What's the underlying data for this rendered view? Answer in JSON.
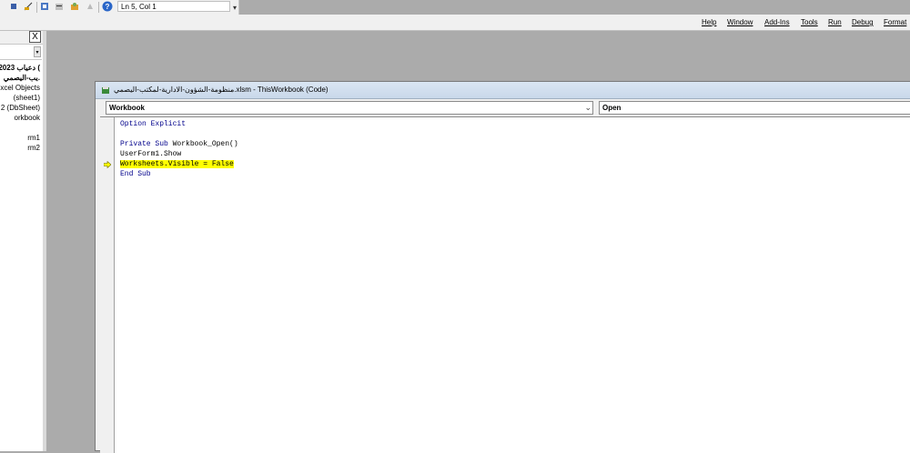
{
  "toolbar": {
    "status": "Ln 5, Col 1"
  },
  "menubar": {
    "items": [
      "Help",
      "Window",
      "Add-Ins",
      "Tools",
      "Run",
      "Debug",
      "Format"
    ]
  },
  "project": {
    "close": "X",
    "tree": [
      {
        "text": "دعياب 2023 (",
        "bold": true
      },
      {
        "text": "يب-اليصمي.",
        "bold": true
      },
      {
        "text": "Excel Objects",
        "bold": false
      },
      {
        "text": "(sheet1)",
        "bold": false
      },
      {
        "text": "2 (DbSheet)",
        "bold": false
      },
      {
        "text": "orkbook",
        "bold": false
      },
      {
        "text": "rm1",
        "bold": false
      },
      {
        "text": "rm2",
        "bold": false
      }
    ]
  },
  "codewin": {
    "title": "منظومة-الشؤون-الادارية-لمكتب-اليصمي.xlsm - ThisWorkbook (Code)",
    "object_combo": "Workbook",
    "proc_combo": "Open",
    "lines": [
      {
        "kw": "Option Explicit",
        "rest": "",
        "hl": false
      },
      {
        "kw": "",
        "rest": "",
        "hl": false
      },
      {
        "kw": "Private Sub ",
        "rest": "Workbook_Open()",
        "hl": false
      },
      {
        "kw": "",
        "rest": "UserForm1.Show",
        "hl": false
      },
      {
        "kw": "",
        "rest": "Worksheets.Visible = False",
        "hl": true
      },
      {
        "kw": "End Sub",
        "rest": "",
        "hl": false
      }
    ]
  },
  "colors": {
    "highlight": "#ffff00",
    "keyword": "#00008b",
    "background": "#ababab"
  }
}
